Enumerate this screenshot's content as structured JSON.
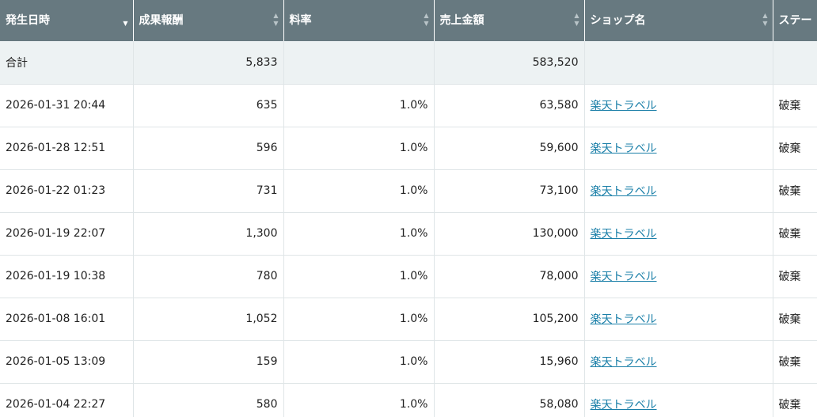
{
  "columns": [
    {
      "label": "発生日時",
      "sort": "desc"
    },
    {
      "label": "成果報酬",
      "sort": "both"
    },
    {
      "label": "料率",
      "sort": "both"
    },
    {
      "label": "売上金額",
      "sort": "both"
    },
    {
      "label": "ショップ名",
      "sort": "both"
    },
    {
      "label": "ステー",
      "sort": "none"
    }
  ],
  "total": {
    "label": "合計",
    "reward": "5,833",
    "rate": "",
    "sales": "583,520",
    "shop": "",
    "status": ""
  },
  "rows": [
    {
      "datetime": "2026-01-31 20:44",
      "reward": "635",
      "rate": "1.0%",
      "sales": "63,580",
      "shop": "楽天トラベル",
      "status": "破棄"
    },
    {
      "datetime": "2026-01-28 12:51",
      "reward": "596",
      "rate": "1.0%",
      "sales": "59,600",
      "shop": "楽天トラベル",
      "status": "破棄"
    },
    {
      "datetime": "2026-01-22 01:23",
      "reward": "731",
      "rate": "1.0%",
      "sales": "73,100",
      "shop": "楽天トラベル",
      "status": "破棄"
    },
    {
      "datetime": "2026-01-19 22:07",
      "reward": "1,300",
      "rate": "1.0%",
      "sales": "130,000",
      "shop": "楽天トラベル",
      "status": "破棄"
    },
    {
      "datetime": "2026-01-19 10:38",
      "reward": "780",
      "rate": "1.0%",
      "sales": "78,000",
      "shop": "楽天トラベル",
      "status": "破棄"
    },
    {
      "datetime": "2026-01-08 16:01",
      "reward": "1,052",
      "rate": "1.0%",
      "sales": "105,200",
      "shop": "楽天トラベル",
      "status": "破棄"
    },
    {
      "datetime": "2026-01-05 13:09",
      "reward": "159",
      "rate": "1.0%",
      "sales": "15,960",
      "shop": "楽天トラベル",
      "status": "破棄"
    },
    {
      "datetime": "2026-01-04 22:27",
      "reward": "580",
      "rate": "1.0%",
      "sales": "58,080",
      "shop": "楽天トラベル",
      "status": "破棄"
    }
  ]
}
